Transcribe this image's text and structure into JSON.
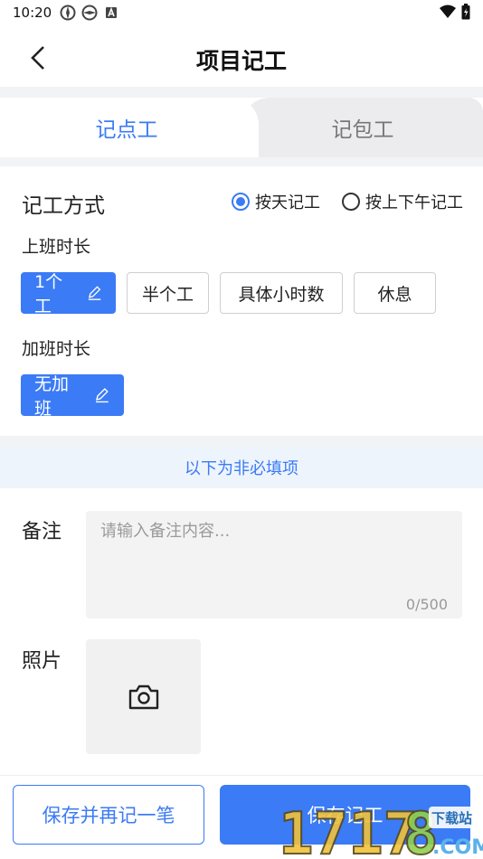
{
  "status": {
    "time": "10:20"
  },
  "nav": {
    "title": "项目记工"
  },
  "tabs": [
    {
      "label": "记点工",
      "active": true
    },
    {
      "label": "记包工",
      "active": false
    }
  ],
  "mode": {
    "label": "记工方式",
    "options": [
      {
        "label": "按天记工",
        "selected": true
      },
      {
        "label": "按上下午记工",
        "selected": false
      }
    ]
  },
  "work_hours": {
    "label": "上班时长",
    "options": [
      {
        "label": "1个工",
        "active": true,
        "editable": true
      },
      {
        "label": "半个工",
        "active": false
      },
      {
        "label": "具体小时数",
        "active": false
      },
      {
        "label": "休息",
        "active": false
      }
    ]
  },
  "overtime": {
    "label": "加班时长",
    "value": "无加班"
  },
  "optional_note": "以下为非必填项",
  "remark": {
    "label": "备注",
    "placeholder": "请输入备注内容...",
    "count": "0/500"
  },
  "photo": {
    "label": "照片"
  },
  "actions": {
    "save_and_next": "保存并再记一笔",
    "save": "保存记工"
  },
  "watermark": {
    "text": "1717 8.COM",
    "badge": "下载站"
  },
  "colors": {
    "accent": "#3b7bf5",
    "tab_inactive_bg": "#ececee",
    "divider": "#f2f3f5",
    "optional_bg": "#eef4fc"
  }
}
